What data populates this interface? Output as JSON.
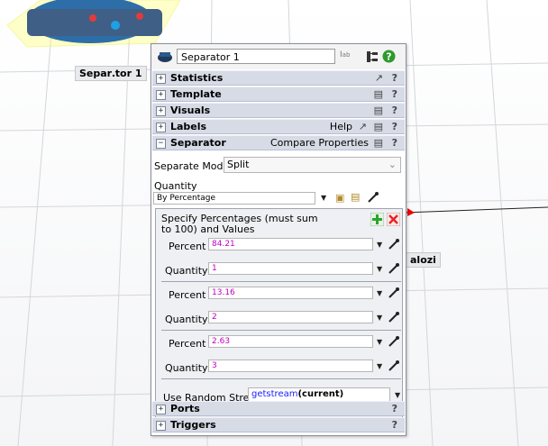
{
  "scene": {
    "object_label_1": "Separ․tor 1",
    "object_label_2": "alozi"
  },
  "window": {
    "name_value": "Separator 1"
  },
  "sections": {
    "statistics": "Statistics",
    "template": "Template",
    "visuals": "Visuals",
    "labels": "Labels",
    "labels_help": "Help",
    "separator": "Separator",
    "separator_compare": "Compare Properties",
    "ports": "Ports",
    "triggers": "Triggers",
    "help_mark": "?"
  },
  "separator": {
    "separate_mode_label": "Separate Mode",
    "separate_mode_value": "Split",
    "quantity_label": "Quantity",
    "quantity_value": "By Percentage"
  },
  "percentages": {
    "heading": "Specify Percentages (must sum to 100) and Values",
    "percent_label": "Percent",
    "quantity_label": "Quantity",
    "rows": [
      {
        "percent": "84.21",
        "quantity": "1"
      },
      {
        "percent": "13.16",
        "quantity": "2"
      },
      {
        "percent": "2.63",
        "quantity": "3"
      }
    ],
    "random_stream_label": "Use Random Stream",
    "random_stream_func": "getstream",
    "random_stream_arg": "(current)"
  },
  "colors": {
    "header_bg": "#d6dbe6",
    "value_magenta": "#c000c0",
    "link_blue": "#1a1aff",
    "help_green": "#2d9a2d"
  }
}
